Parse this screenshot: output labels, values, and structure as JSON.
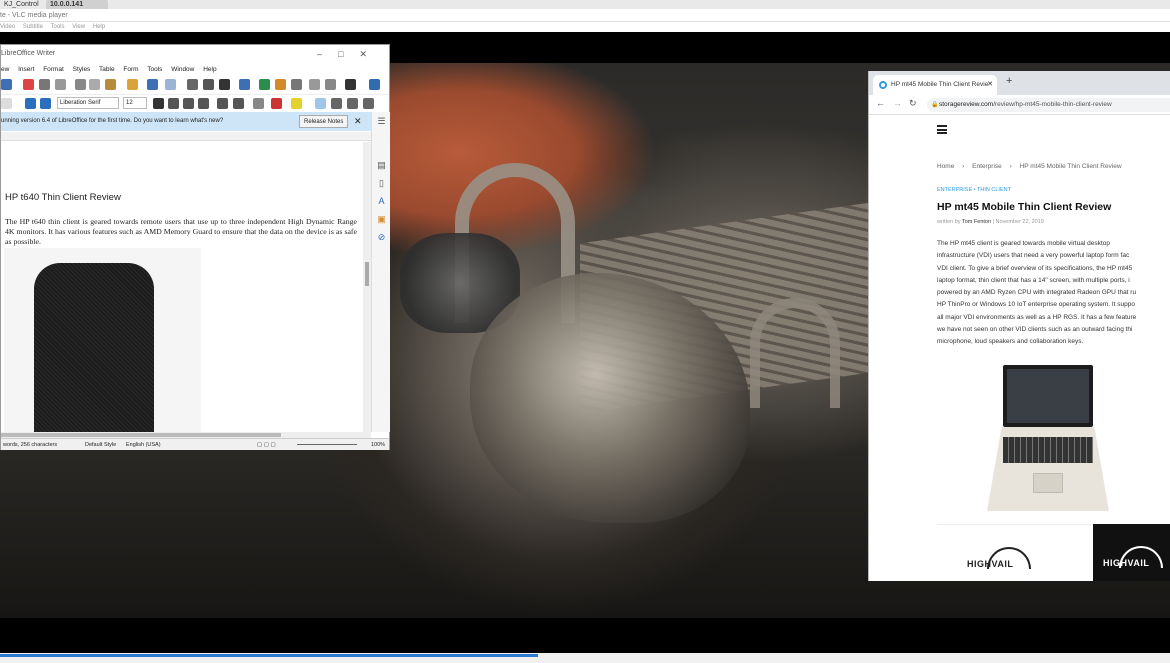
{
  "taskbar_tabs": {
    "tab1": "KJ_Control",
    "tab2": "10.0.0.141"
  },
  "vlc": {
    "title": "te - VLC media player",
    "menu": [
      "Video",
      "Subtitle",
      "Tools",
      "View",
      "Help"
    ],
    "progress_fraction": 0.46,
    "colors": {
      "progress": "#2c7cd1"
    }
  },
  "writer": {
    "title": "LibreOffice Writer",
    "menu": [
      "ew",
      "Insert",
      "Format",
      "Styles",
      "Table",
      "Form",
      "Tools",
      "Window",
      "Help"
    ],
    "font_name": "Liberation Serif",
    "font_size": "12",
    "infobar_text": "unning version 6.4 of LibreOffice for the first time. Do you want to learn what's new?",
    "release_notes_button": "Release Notes",
    "doc_heading": "HP t640 Thin Client Review",
    "doc_paragraph": "The HP t640 thin client is geared towards remote users that use up to three independent High Dynamic Range 4K monitors. It has various features such as AMD Memory Guard to ensure that the data on the device is as safe as possible.",
    "status": {
      "word_count": "words, 256 characters",
      "page_style": "Default Style",
      "language": "English (USA)",
      "zoom": "100%"
    }
  },
  "browser": {
    "tab_title": "HP mt45 Mobile Thin Client Revie",
    "url_host": "storagereview.com",
    "url_path": "/review/hp-mt45-mobile-thin-client-review",
    "breadcrumbs": [
      "Home",
      "›",
      "Enterprise",
      "›",
      "HP mt45 Mobile Thin Client Review"
    ],
    "categories": "ENTERPRISE  •  THIN CLIENT",
    "article_title": "HP mt45 Mobile Thin Client Review",
    "byline_prefix": "written by",
    "author": "Tom Fenton",
    "date": "November 22, 2019",
    "body_lines": [
      "The HP mt45 client is geared towards mobile virtual desktop",
      "infrastructure (VDI) users that need a very powerful laptop form fac",
      "VDI client. To give a brief overview of its specifications, the HP mt45",
      "laptop format, thin client that has a 14\" screen, with multiple ports, i",
      "powered by an AMD Ryzen CPU with integrated Radeon GPU that ru",
      "HP ThinPro or Windows 10 IoT enterprise operating system. It suppo",
      "all major VDI environments as well as a HP RGS. It has a few feature",
      "we have not seen on other VID clients such as an outward facing thi",
      "microphone, loud speakers and collaboration keys."
    ],
    "ad_logo": "HIGHVAIL",
    "colors": {
      "accent": "#2f9de0"
    }
  }
}
